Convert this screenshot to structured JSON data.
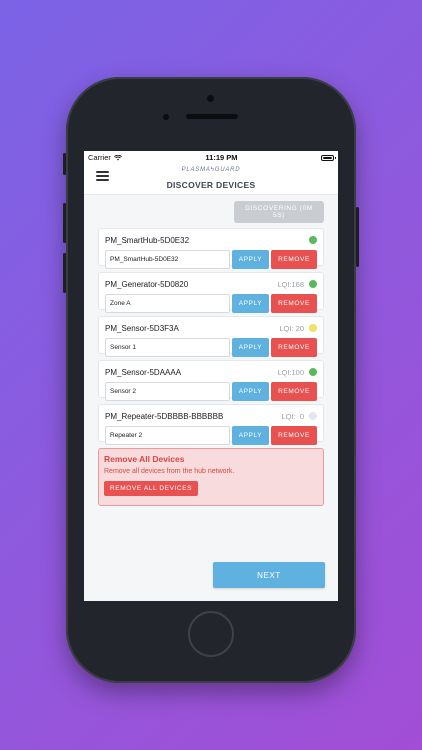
{
  "status_bar": {
    "carrier": "Carrier",
    "wifi_icon": "wifi-icon",
    "time": "11:19 PM",
    "battery_icon": "battery-icon"
  },
  "header": {
    "menu_icon": "hamburger-menu-icon",
    "logo_text": "PLASMA GUARD",
    "title": "DISCOVER DEVICES"
  },
  "discover_button": {
    "label": "DISCOVERING (0M 5S)"
  },
  "colors": {
    "accent": "#5fb2e0",
    "danger": "#e8514f",
    "green": "#5cb85c",
    "yellow": "#f2df6a",
    "gray": "#e4e6e9"
  },
  "devices": [
    {
      "name": "PM_SmartHub-5D0E32",
      "lqi": "",
      "status_color": "#5cb85c",
      "input_value": "PM_SmartHub-5D0E32",
      "apply_label": "APPLY",
      "remove_label": "REMOVE"
    },
    {
      "name": "PM_Generator-5D0820",
      "lqi": "LQI:168",
      "status_color": "#5cb85c",
      "input_value": "Zone A",
      "apply_label": "APPLY",
      "remove_label": "REMOVE"
    },
    {
      "name": "PM_Sensor-5D3F3A",
      "lqi": "LQI: 20",
      "status_color": "#f2df6a",
      "input_value": "Sensor 1",
      "apply_label": "APPLY",
      "remove_label": "REMOVE"
    },
    {
      "name": "PM_Sensor-5DAAAA",
      "lqi": "LQI:100",
      "status_color": "#5cb85c",
      "input_value": "Sensor 2",
      "apply_label": "APPLY",
      "remove_label": "REMOVE"
    },
    {
      "name": "PM_Repeater-5DBBBB-BBBBBB",
      "lqi": "LQI:  0",
      "status_color": "#e4e6e9",
      "input_value": "Repeater 2",
      "apply_label": "APPLY",
      "remove_label": "REMOVE"
    }
  ],
  "remove_all": {
    "title": "Remove All Devices",
    "description": "Remove all devices from the hub network.",
    "button_label": "REMOVE ALL DEVICES"
  },
  "next_button": {
    "label": "NEXT"
  }
}
